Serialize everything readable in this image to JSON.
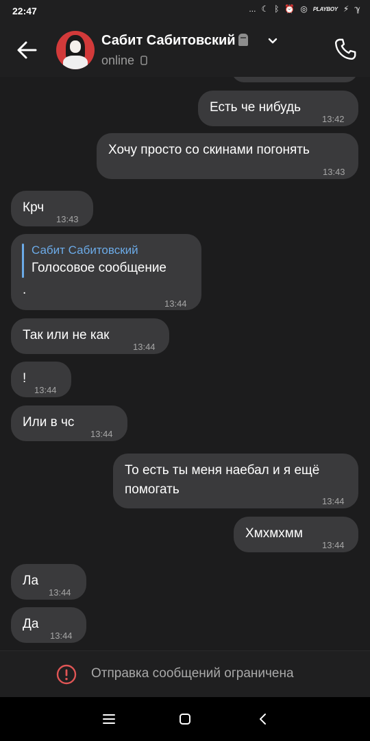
{
  "status_bar": {
    "time": "22:47",
    "dots": "...",
    "brand_badge": "PLAYBOY"
  },
  "header": {
    "contact_name": "Сабит Сабитовский",
    "status": "online"
  },
  "messages": [
    {
      "id": "m0",
      "side": "out",
      "text": "",
      "time": ""
    },
    {
      "id": "m1",
      "side": "out",
      "text": "Есть че нибудь",
      "time": "13:42"
    },
    {
      "id": "m2",
      "side": "out",
      "text": "Хочу просто со скинами погонять",
      "time": "13:43"
    },
    {
      "id": "m3",
      "side": "in",
      "text": "Крч",
      "time": "13:43"
    },
    {
      "id": "m4",
      "side": "in",
      "reply_to_name": "Сабит Сабитовский",
      "reply_to_text": "Голосовое сообщение",
      "text": ".",
      "time": "13:44"
    },
    {
      "id": "m5",
      "side": "in",
      "text": "Так или не как",
      "time": "13:44"
    },
    {
      "id": "m6",
      "side": "in",
      "text": "!",
      "time": "13:44"
    },
    {
      "id": "m7",
      "side": "in",
      "text": "Или в чс",
      "time": "13:44"
    },
    {
      "id": "m8",
      "side": "out",
      "text_line1": "То есть ты меня наебал и я ещё",
      "text_line2": "помогать",
      "time": "13:44"
    },
    {
      "id": "m9",
      "side": "out",
      "text": "Хмхмхмм",
      "time": "13:44"
    },
    {
      "id": "m10",
      "side": "in",
      "text": "Ла",
      "time": "13:44"
    },
    {
      "id": "m11",
      "side": "in",
      "text": "Да",
      "time": "13:44"
    }
  ],
  "footer": {
    "restricted_text": "Отправка сообщений ограничена"
  },
  "icons": {
    "back": "back-arrow-icon",
    "phone": "phone-icon",
    "chevron": "chevron-down-icon",
    "restricted": "exclamation-circle-icon",
    "nav_menu": "menu-icon",
    "nav_home": "home-icon",
    "nav_back": "back-icon"
  },
  "colors": {
    "background": "#1c1c1d",
    "bubble": "#3a3a3c",
    "accent_blue": "#6cabe8",
    "warning_red": "#e05555"
  }
}
